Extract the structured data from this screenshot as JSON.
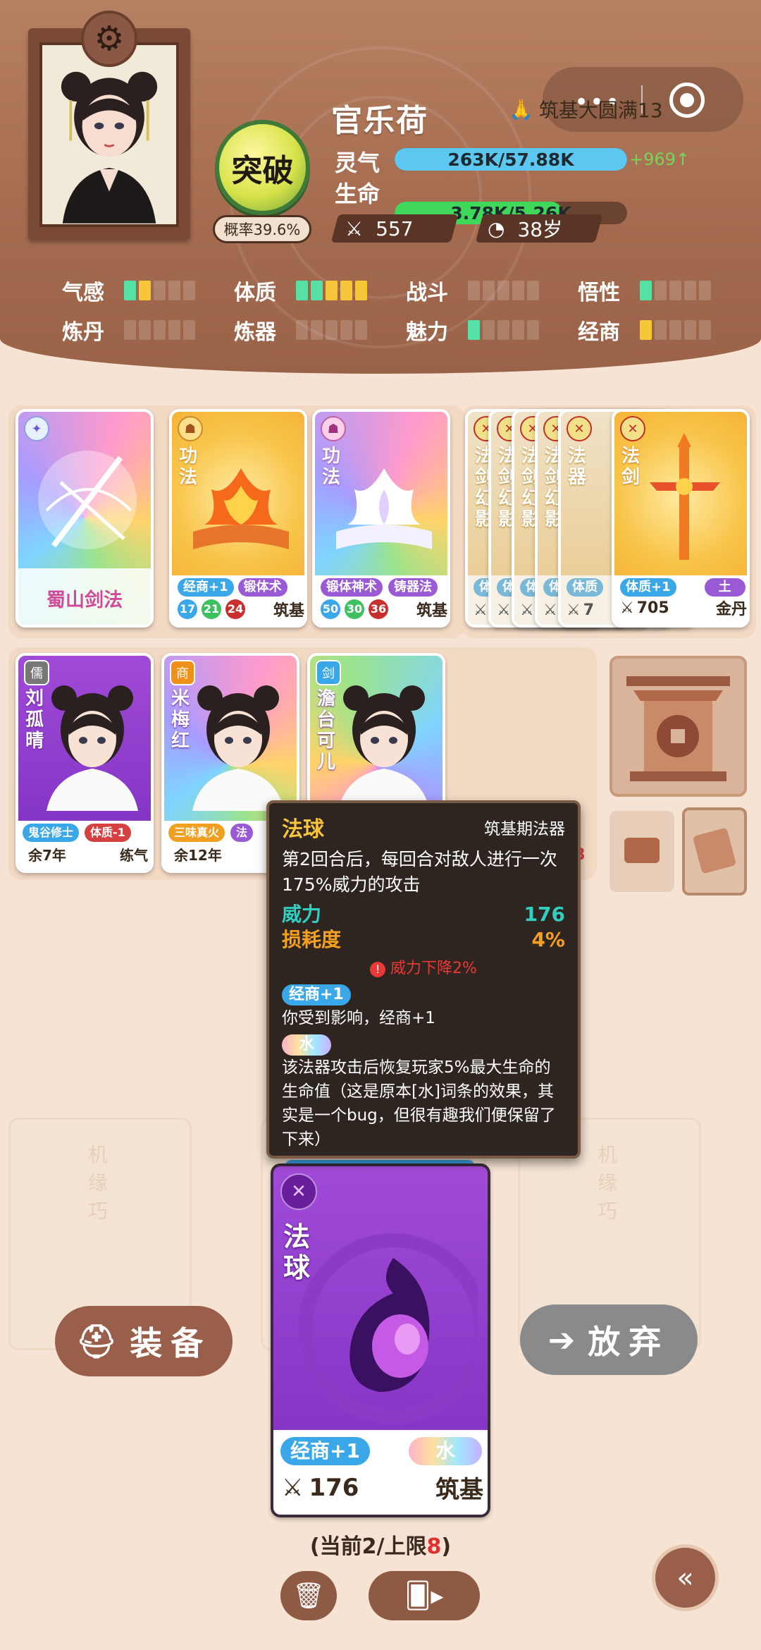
{
  "header": {
    "name": "官乐荷",
    "realm": "筑基大圆满13",
    "breakthrough_label": "突破",
    "probability": "概率39.6%",
    "lingqi": {
      "label": "灵气",
      "value": "263K/57.88K",
      "fill": 1.0,
      "gain": "+969↑",
      "color": "#5cc8f2"
    },
    "shengming": {
      "label": "生命",
      "value": "3.78K/5.26K",
      "fill": 0.72,
      "color": "#3fd85a"
    },
    "power": "557",
    "age": "38岁"
  },
  "attributes": [
    {
      "name": "气感",
      "pips": [
        "g",
        "y",
        "0",
        "0",
        "0"
      ]
    },
    {
      "name": "体质",
      "pips": [
        "g",
        "g",
        "y",
        "y",
        "y"
      ]
    },
    {
      "name": "战斗",
      "pips": [
        "0",
        "0",
        "0",
        "0",
        "0"
      ]
    },
    {
      "name": "悟性",
      "pips": [
        "g",
        "0",
        "0",
        "0",
        "0"
      ]
    },
    {
      "name": "炼丹",
      "pips": [
        "0",
        "0",
        "0",
        "0",
        "0"
      ]
    },
    {
      "name": "炼器",
      "pips": [
        "0",
        "0",
        "0",
        "0",
        "0"
      ]
    },
    {
      "name": "魅力",
      "pips": [
        "g",
        "0",
        "0",
        "0",
        "0"
      ]
    },
    {
      "name": "经商",
      "pips": [
        "y",
        "0",
        "0",
        "0",
        "0"
      ]
    }
  ],
  "equip_cards": [
    {
      "name": "蜀山剑法",
      "style": "rainbow"
    },
    {
      "type_label": "功法",
      "tags": [
        "经商+1",
        "锻体术"
      ],
      "nums": [
        "17",
        "21",
        "24"
      ],
      "realm": "筑基"
    },
    {
      "type_label": "功法",
      "tags": [
        "锻体神术",
        "铸器法"
      ],
      "nums": [
        "50",
        "30",
        "36"
      ],
      "realm": "筑基"
    }
  ],
  "stacked_cards": [
    {
      "title": "法剑幻影",
      "tag": "体质"
    },
    {
      "title": "法剑幻影",
      "tag": "体质"
    },
    {
      "title": "法剑幻影",
      "tag": "体质"
    },
    {
      "title": "法剑幻影",
      "tag": "体质"
    },
    {
      "title": "法器",
      "tag": "体质"
    }
  ],
  "stack_power_prefix": "7",
  "front_sword": {
    "title": "法剑",
    "tags": [
      "体质+1",
      "土"
    ],
    "power": "705",
    "realm": "金丹"
  },
  "npcs": [
    {
      "badge": "儒",
      "name": "刘孤晴",
      "tags": [
        "鬼谷修士",
        "体质-1"
      ],
      "life": "余7年",
      "realm": "练气"
    },
    {
      "badge": "商",
      "name": "米梅红",
      "tags": [
        "三味真火",
        "法"
      ],
      "life": "余12年",
      "realm": "练"
    },
    {
      "badge": "剑",
      "name": "澹台可儿"
    }
  ],
  "npc_cutoff_digit": "8",
  "tooltip": {
    "name": "法球",
    "subtitle": "筑基期法器",
    "desc": "第2回合后，每回合对敌人进行一次175%威力的攻击",
    "power_label": "威力",
    "power_value": "176",
    "wear_label": "损耗度",
    "wear_value": "4%",
    "warning": "威力下降2%",
    "trait1_tag": "经商+1",
    "trait1_desc": "你受到影响，经商+1",
    "trait2_tag": "水",
    "trait2_desc": "该法器攻击后恢复玩家5%最大生命的生命值（这是原本[水]词条的效果，其实是一个bug，但很有趣我们便保留了下来）"
  },
  "selected_card": {
    "title": "法球",
    "tags": [
      "经商+1",
      "水"
    ],
    "power": "176",
    "realm": "筑基"
  },
  "actions": {
    "equip": "装备",
    "discard": "放弃"
  },
  "capacity": {
    "prefix": "(当前2/上限",
    "limit": "8",
    "suffix": ")"
  },
  "ghost_text": "机缘巧"
}
